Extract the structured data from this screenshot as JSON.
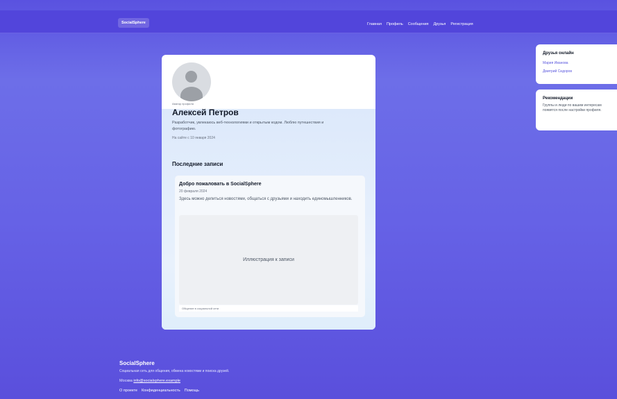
{
  "header": {
    "brand": "SocialSphere",
    "nav": [
      "Главная",
      "Профиль",
      "Сообщения",
      "Друзья",
      "Регистрация"
    ]
  },
  "profile": {
    "avatar_caption": "Аватар профиля",
    "name": "Алексей Петров",
    "bio": "Разработчик, увлекаюсь веб-технологиями и открытым кодом. Люблю путешествия и фотографию.",
    "joined": "На сайте с 10 января 2024"
  },
  "posts": {
    "section_title": "Последние записи",
    "items": [
      {
        "title": "Добро пожаловать в SocialSphere",
        "date": "20 февраля 2024",
        "text": "Здесь можно делиться новостями, общаться с друзьями и находить единомышленников.",
        "image_label": "Иллюстрация к записи",
        "image_caption": "Общение в социальной сети"
      }
    ]
  },
  "sidebar": {
    "friends_title": "Друзья онлайн",
    "friends": [
      "Мария Иванова",
      "Дмитрий Сидоров"
    ],
    "recs_title": "Рекомендации",
    "recs_text": "Группы и люди по вашим интересам появятся после настройки профиля."
  },
  "footer": {
    "brand": "SocialSphere",
    "description": "Социальная сеть для общения, обмена новостями и поиска друзей.",
    "city": "Москва",
    "email": "info@socialsphere.example",
    "links": [
      "О проекте",
      "Конфиденциальность",
      "Помощь"
    ]
  },
  "colors": {
    "background": "#5a52e0",
    "accent_link": "#5b58de",
    "card_tint": "#dde9fb"
  }
}
